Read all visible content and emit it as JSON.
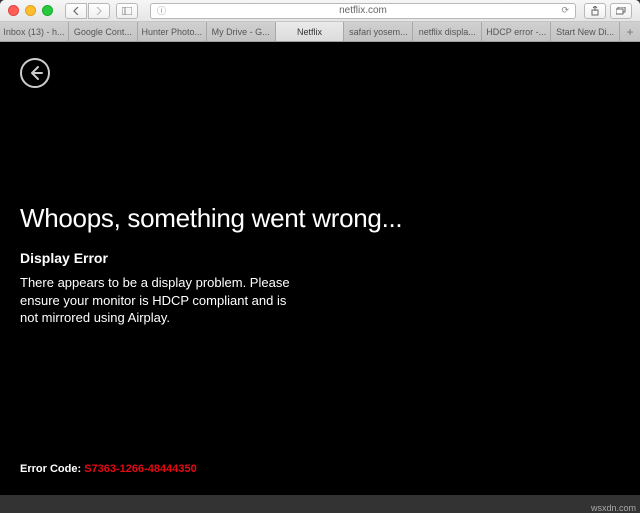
{
  "toolbar": {
    "address": "netflix.com"
  },
  "tabs": [
    {
      "label": "Inbox (13) - h...",
      "active": false
    },
    {
      "label": "Google Cont...",
      "active": false
    },
    {
      "label": "Hunter Photo...",
      "active": false
    },
    {
      "label": "My Drive - G...",
      "active": false
    },
    {
      "label": "Netflix",
      "active": true
    },
    {
      "label": "safari yosem...",
      "active": false
    },
    {
      "label": "netflix displa...",
      "active": false
    },
    {
      "label": "HDCP error -...",
      "active": false
    },
    {
      "label": "Start New Di...",
      "active": false
    }
  ],
  "error": {
    "heading": "Whoops, something went wrong...",
    "title": "Display Error",
    "body": "There appears to be a display problem. Please ensure your monitor is HDCP compliant and is not mirrored using Airplay.",
    "code_label": "Error Code: ",
    "code_value": "S7363-1266-48444350"
  },
  "watermark": "wsxdn.com"
}
